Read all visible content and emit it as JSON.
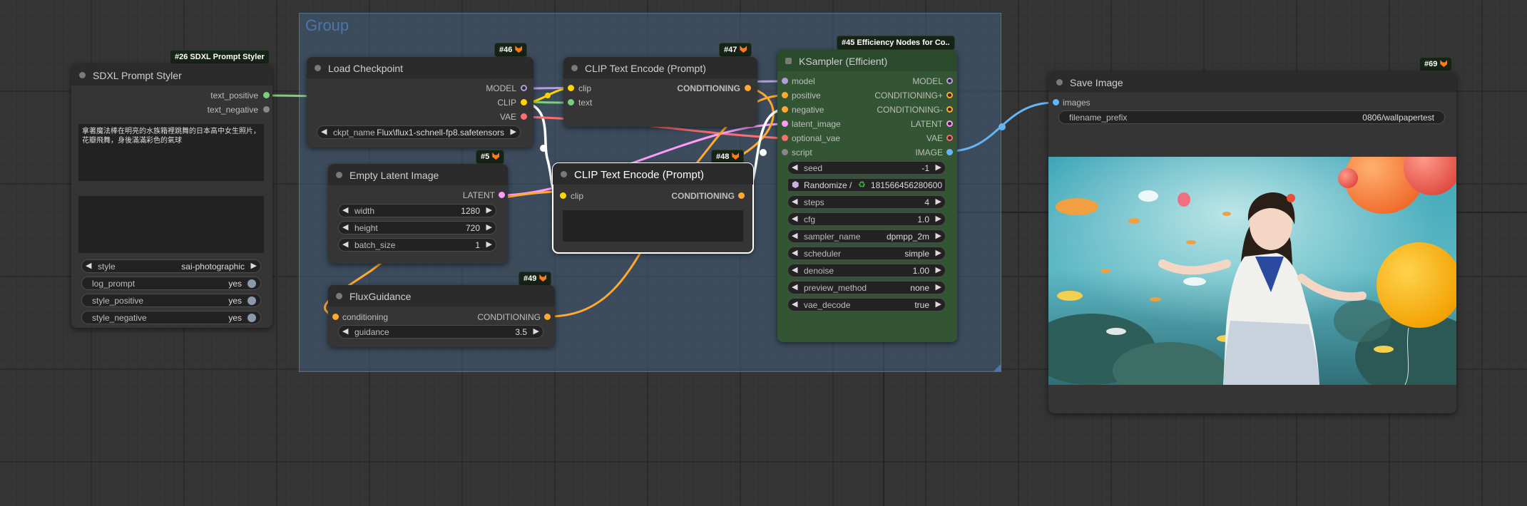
{
  "group": {
    "title": "Group"
  },
  "nodes": {
    "sdxl": {
      "badge": "#26 SDXL Prompt Styler",
      "title": "SDXL Prompt Styler",
      "outputs": [
        "text_positive",
        "text_negative"
      ],
      "prompt_text": "拿著魔法棒在明亮的水族箱裡跳舞的日本高中女生照片，花瓣飛舞，身後滿滿彩色的氣球",
      "negative_text": "",
      "style": {
        "label": "style",
        "value": "sai-photographic"
      },
      "toggles": [
        {
          "label": "log_prompt",
          "value": "yes"
        },
        {
          "label": "style_positive",
          "value": "yes"
        },
        {
          "label": "style_negative",
          "value": "yes"
        }
      ]
    },
    "ckpt": {
      "badge": "#46",
      "title": "Load Checkpoint",
      "outputs": [
        "MODEL",
        "CLIP",
        "VAE"
      ],
      "ckpt_label": "ckpt_name",
      "ckpt_value": "Flux\\flux1-schnell-fp8.safetensors"
    },
    "clip47": {
      "badge": "#47",
      "title": "CLIP Text Encode (Prompt)",
      "inputs": [
        "clip",
        "text"
      ],
      "output": "CONDITIONING"
    },
    "latent": {
      "badge": "#5",
      "title": "Empty Latent Image",
      "output": "LATENT",
      "widgets": [
        {
          "label": "width",
          "value": "1280"
        },
        {
          "label": "height",
          "value": "720"
        },
        {
          "label": "batch_size",
          "value": "1"
        }
      ]
    },
    "clip48": {
      "badge": "#48",
      "title": "CLIP Text Encode (Prompt)",
      "input": "clip",
      "output": "CONDITIONING",
      "text": ""
    },
    "flux": {
      "badge": "#49",
      "title": "FluxGuidance",
      "input": "conditioning",
      "output": "CONDITIONING",
      "guidance": {
        "label": "guidance",
        "value": "3.5"
      }
    },
    "ksampler": {
      "badge": "#45 Efficiency Nodes for Co..",
      "title": "KSampler (Efficient)",
      "inputs": [
        "model",
        "positive",
        "negative",
        "latent_image",
        "optional_vae",
        "script"
      ],
      "outputs": [
        "MODEL",
        "CONDITIONING+",
        "CONDITIONING-",
        "LATENT",
        "VAE",
        "IMAGE"
      ],
      "seed": {
        "label": "seed",
        "value": "-1"
      },
      "randomize": {
        "label": "Randomize /",
        "value": "181566456280600"
      },
      "widgets": [
        {
          "label": "steps",
          "value": "4"
        },
        {
          "label": "cfg",
          "value": "1.0"
        },
        {
          "label": "sampler_name",
          "value": "dpmpp_2m"
        },
        {
          "label": "scheduler",
          "value": "simple"
        },
        {
          "label": "denoise",
          "value": "1.00"
        },
        {
          "label": "preview_method",
          "value": "none"
        },
        {
          "label": "vae_decode",
          "value": "true"
        }
      ]
    },
    "save": {
      "badge": "#69",
      "title": "Save Image",
      "input": "images",
      "prefix": {
        "label": "filename_prefix",
        "value": "0806/wallpapertest"
      }
    }
  },
  "colors": {
    "model": "#b39ddb",
    "clip": "#ffd500",
    "vae": "#ff6e6e",
    "conditioning": "#ffa931",
    "latent": "#ff9cf9",
    "image": "#64b5f6",
    "string": "#7ccd7c",
    "canvas": "#353535",
    "group": "#4b77a6",
    "node_green": "#335533"
  }
}
